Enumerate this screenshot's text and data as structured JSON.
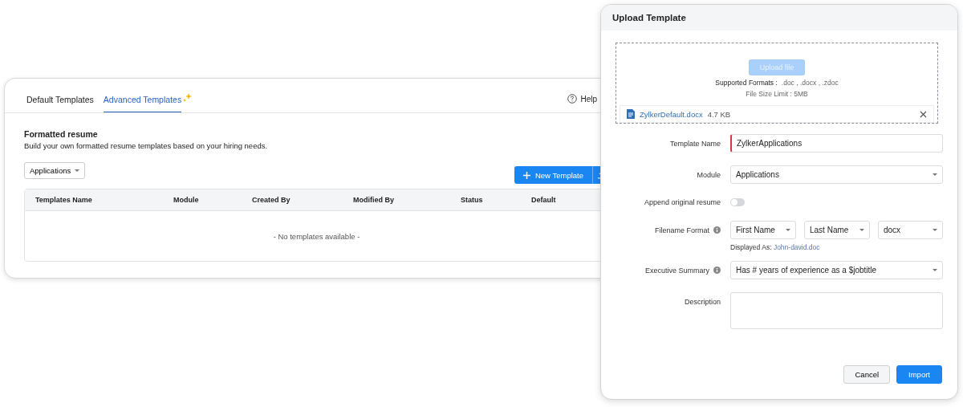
{
  "page": {
    "tabs": [
      {
        "label": "Default Templates",
        "selected": false,
        "sparkle": false
      },
      {
        "label": "Advanced Templates",
        "selected": true,
        "sparkle": true
      }
    ],
    "help": "Help",
    "section_title": "Formatted resume",
    "section_description": "Build your own formatted resume templates based on your hiring needs.",
    "module_filter": "Applications",
    "new_template_button": "New Template",
    "table": {
      "columns": [
        "Templates Name",
        "Module",
        "Created By",
        "Modified By",
        "Status",
        "Default"
      ],
      "empty_message": "- No templates available -"
    }
  },
  "dialog": {
    "title": "Upload Template",
    "upload_button": {
      "label": "Upload file",
      "disabled": true
    },
    "supported_formats_label": "Supported Formats :",
    "supported_formats": ".doc , .docx , .zdoc",
    "size_limit": "File Size Limit : 5MB",
    "file": {
      "name": "ZylkerDefault.docx",
      "size": "4.7 KB"
    },
    "fields": [
      {
        "kind": "text",
        "label": "Template Name",
        "value": "ZylkerApplications",
        "required": true,
        "info": false
      },
      {
        "kind": "select",
        "label": "Module",
        "value": "Applications",
        "info": false
      },
      {
        "kind": "toggle",
        "label": "Append original resume",
        "on": false,
        "info": false
      },
      {
        "kind": "selects",
        "label": "Filename Format",
        "values": [
          "First Name",
          "Last Name",
          "docx"
        ],
        "hint_label": "Displayed As:",
        "hint_value": "John-david.doc",
        "info": true
      },
      {
        "kind": "select",
        "label": "Executive Summary",
        "value": "Has # years of experience as a $jobtitle",
        "info": true
      },
      {
        "kind": "textarea",
        "label": "Description",
        "info": false
      }
    ],
    "buttons": [
      "Cancel",
      "Import"
    ]
  }
}
